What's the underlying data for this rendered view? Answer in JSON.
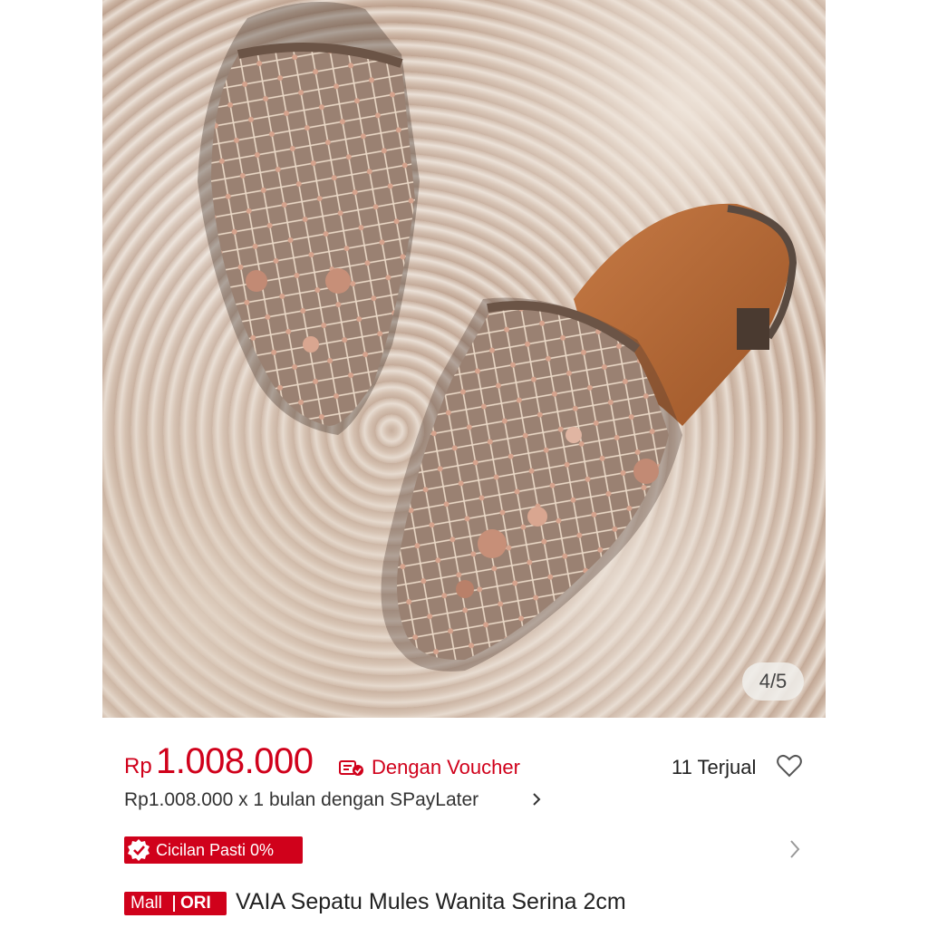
{
  "gallery": {
    "counter": "4/5",
    "image_alt": "Embroidered pointed-toe mule shoes on a patterned carpet",
    "insole_brand": "VAIA"
  },
  "price": {
    "currency": "Rp",
    "amount": "1.008.000",
    "voucher_label": "Dengan Voucher",
    "color": "#d0011b"
  },
  "sales": {
    "sold": "11 Terjual"
  },
  "paylater": {
    "text": "Rp1.008.000 x 1 bulan dengan SPayLater"
  },
  "installment": {
    "badge": "Cicilan Pasti 0%"
  },
  "product": {
    "badge_mall": "Mall",
    "badge_ori": "ORI",
    "title": "VAIA Sepatu Mules Wanita Serina 2cm"
  },
  "icons": [
    "voucher-icon",
    "heart-icon",
    "chevron-right-icon",
    "check-badge-icon"
  ]
}
